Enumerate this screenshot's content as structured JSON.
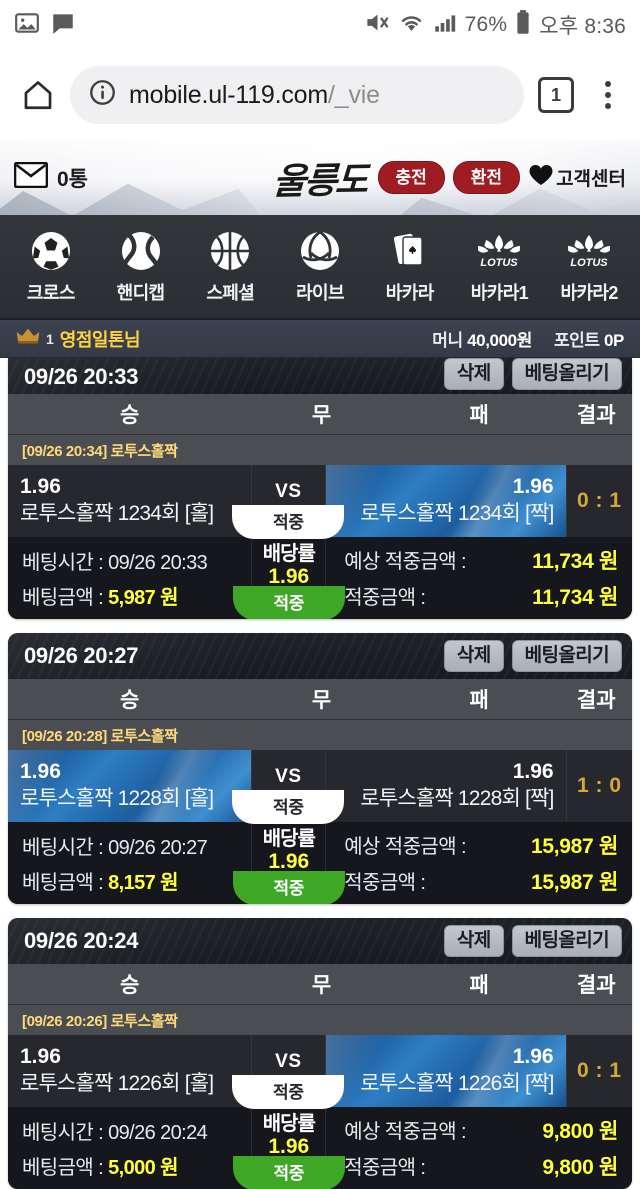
{
  "status_bar": {
    "left_icons": [
      "image-icon",
      "chat-bubble-icon"
    ],
    "mute_icon": "mute-icon",
    "wifi_icon": "wifi-icon",
    "signal_icon": "signal-bars-icon",
    "battery_percent": "76%",
    "battery_icon": "battery-icon",
    "time": "오후 8:36"
  },
  "browser": {
    "home_icon": "home-icon",
    "info_icon": "info-circle-icon",
    "url_host": "mobile.ul-119.com",
    "url_path": "/_vie",
    "tab_count": "1",
    "menu_icon": "overflow-menu-icon"
  },
  "site_header": {
    "mail_icon": "envelope-icon",
    "mail_count": "0통",
    "logo": "울릉도",
    "deposit_label": "충전",
    "withdraw_label": "환전",
    "heart_icon": "heart-icon",
    "support_label": "고객센터",
    "accent_red": "#a01c23"
  },
  "nav": {
    "items": [
      {
        "label": "크로스",
        "icon": "soccer-ball-icon"
      },
      {
        "label": "핸디캡",
        "icon": "baseball-icon"
      },
      {
        "label": "스페셜",
        "icon": "basketball-icon"
      },
      {
        "label": "라이브",
        "icon": "volleyball-icon"
      },
      {
        "label": "바카라",
        "icon": "playing-cards-icon"
      },
      {
        "label": "바카라1",
        "icon": "lotus-icon"
      },
      {
        "label": "바카라2",
        "icon": "lotus-icon"
      }
    ]
  },
  "user_bar": {
    "rank_icon": "crown-rank-icon",
    "rank_num": "1",
    "username": "영점일톤님",
    "money_label": "머니",
    "money_value": "40,000원",
    "point_label": "포인트",
    "point_value": "0P",
    "username_color": "#ffd23f"
  },
  "columns": {
    "win": "승",
    "draw": "무",
    "lose": "패",
    "result": "결과"
  },
  "labels": {
    "delete": "삭제",
    "raise_bet": "베팅올리기",
    "vs": "VS",
    "hit": "적중",
    "rate": "배당률",
    "bet_time": "베팅시간 :",
    "bet_amount": "베팅금액 :",
    "expected_win": "예상 적중금액 :",
    "win_amount": "적중금액 :",
    "currency": "원"
  },
  "colors": {
    "amount_yellow": "#ffff3b",
    "result_gold": "#d4a93a",
    "hit_green": "#3fa726",
    "selected_blue": "#2e7ec4"
  },
  "bets": [
    {
      "bet_time": "09/26 20:33",
      "match_title": "[09/26 20:34] 로투스홀짝",
      "home_odds": "1.96",
      "home_team": "로투스홀짝 1234회 [홀]",
      "away_odds": "1.96",
      "away_team": "로투스홀짝 1234회 [짝]",
      "selected": "away",
      "result": "0 : 1",
      "bet_time_value": "09/26 20:33",
      "bet_amount_value": "5,987 원",
      "rate": "1.96",
      "status": "적중",
      "expected_value": "11,734 원",
      "win_value": "11,734 원"
    },
    {
      "bet_time": "09/26 20:27",
      "match_title": "[09/26 20:28] 로투스홀짝",
      "home_odds": "1.96",
      "home_team": "로투스홀짝 1228회 [홀]",
      "away_odds": "1.96",
      "away_team": "로투스홀짝 1228회 [짝]",
      "selected": "home",
      "result": "1 : 0",
      "bet_time_value": "09/26 20:27",
      "bet_amount_value": "8,157 원",
      "rate": "1.96",
      "status": "적중",
      "expected_value": "15,987 원",
      "win_value": "15,987 원"
    },
    {
      "bet_time": "09/26 20:24",
      "match_title": "[09/26 20:26] 로투스홀짝",
      "home_odds": "1.96",
      "home_team": "로투스홀짝 1226회 [홀]",
      "away_odds": "1.96",
      "away_team": "로투스홀짝 1226회 [짝]",
      "selected": "away",
      "result": "0 : 1",
      "bet_time_value": "09/26 20:24",
      "bet_amount_value": "5,000 원",
      "rate": "1.96",
      "status": "적중",
      "expected_value": "9,800 원",
      "win_value": "9,800 원"
    }
  ]
}
